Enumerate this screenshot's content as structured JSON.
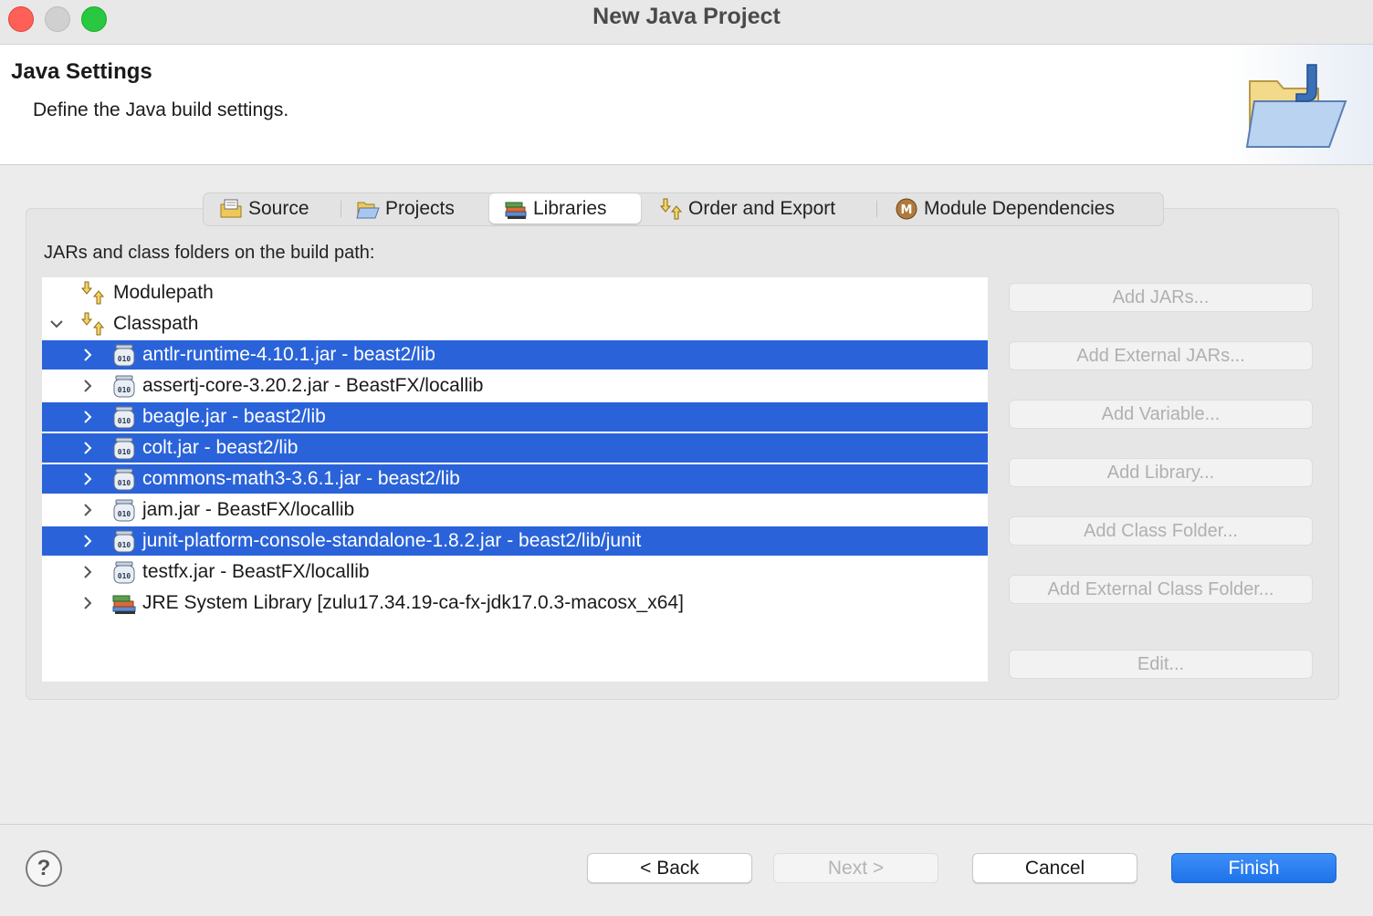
{
  "window": {
    "title": "New Java Project"
  },
  "header": {
    "title": "Java Settings",
    "description": "Define the Java build settings."
  },
  "tabs": [
    {
      "label": "Source",
      "icon": "source-folder-icon",
      "active": false
    },
    {
      "label": "Projects",
      "icon": "projects-folder-icon",
      "active": false
    },
    {
      "label": "Libraries",
      "icon": "libraries-books-icon",
      "active": true
    },
    {
      "label": "Order and Export",
      "icon": "order-arrows-icon",
      "active": false
    },
    {
      "label": "Module Dependencies",
      "icon": "module-m-icon",
      "active": false
    }
  ],
  "build_path": {
    "label": "JARs and class folders on the build path:",
    "entries": [
      {
        "label": "Modulepath",
        "icon": "path-arrows-icon",
        "expander": "none",
        "selected": false
      },
      {
        "label": "Classpath",
        "icon": "path-arrows-icon",
        "expander": "expanded",
        "selected": false
      },
      {
        "label": "antlr-runtime-4.10.1.jar - beast2/lib",
        "icon": "jar-icon",
        "expander": "collapsed",
        "selected": true
      },
      {
        "label": "assertj-core-3.20.2.jar - BeastFX/locallib",
        "icon": "jar-icon",
        "expander": "collapsed",
        "selected": false
      },
      {
        "label": "beagle.jar - beast2/lib",
        "icon": "jar-icon",
        "expander": "collapsed",
        "selected": true
      },
      {
        "label": "colt.jar - beast2/lib",
        "icon": "jar-icon",
        "expander": "collapsed",
        "selected": true
      },
      {
        "label": "commons-math3-3.6.1.jar - beast2/lib",
        "icon": "jar-icon",
        "expander": "collapsed",
        "selected": true
      },
      {
        "label": "jam.jar - BeastFX/locallib",
        "icon": "jar-icon",
        "expander": "collapsed",
        "selected": false
      },
      {
        "label": "junit-platform-console-standalone-1.8.2.jar - beast2/lib/junit",
        "icon": "jar-icon",
        "expander": "collapsed",
        "selected": true
      },
      {
        "label": "testfx.jar - BeastFX/locallib",
        "icon": "jar-icon",
        "expander": "collapsed",
        "selected": false
      },
      {
        "label": "JRE System Library [zulu17.34.19-ca-fx-jdk17.0.3-macosx_x64]",
        "icon": "library-books-icon",
        "expander": "collapsed",
        "selected": false
      }
    ]
  },
  "side_buttons": [
    {
      "label": "Add JARs...",
      "enabled": false
    },
    {
      "label": "Add External JARs...",
      "enabled": false
    },
    {
      "label": "Add Variable...",
      "enabled": false
    },
    {
      "label": "Add Library...",
      "enabled": false
    },
    {
      "label": "Add Class Folder...",
      "enabled": false
    },
    {
      "label": "Add External Class Folder...",
      "enabled": false
    },
    {
      "label": "Edit...",
      "enabled": false
    }
  ],
  "footer": {
    "help": "?",
    "back": "< Back",
    "next": "Next >",
    "cancel": "Cancel",
    "finish": "Finish"
  },
  "colors": {
    "selection": "#2a63d9",
    "primary_button": "#1f73ea"
  }
}
